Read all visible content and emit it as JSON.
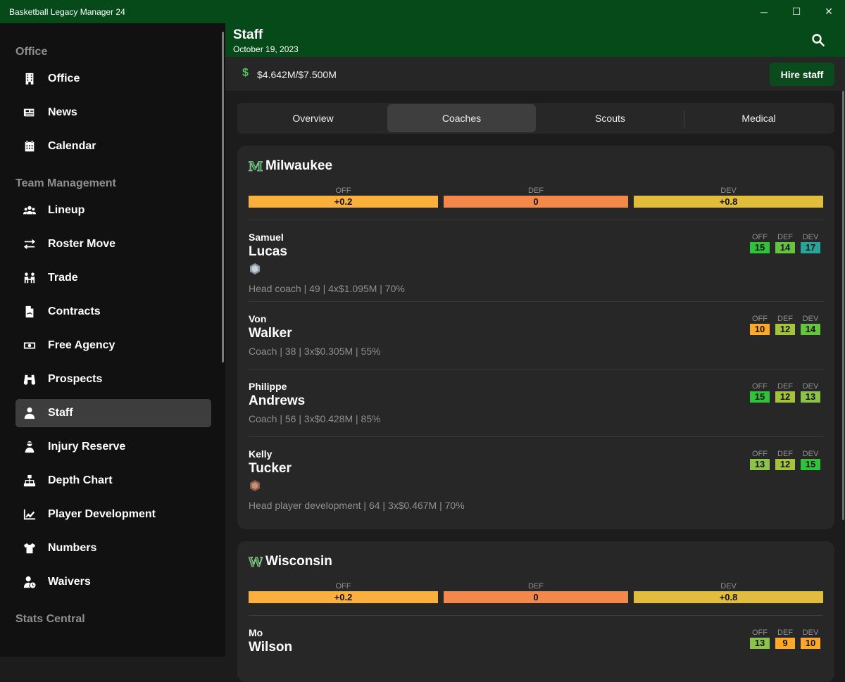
{
  "window": {
    "title": "Basketball Legacy Manager 24",
    "minimize": "─",
    "maximize": "☐",
    "close": "✕"
  },
  "sidebar": {
    "sections": [
      {
        "label": "Office",
        "items": [
          {
            "label": "Office",
            "icon": "building-icon"
          },
          {
            "label": "News",
            "icon": "newspaper-icon"
          },
          {
            "label": "Calendar",
            "icon": "calendar-icon"
          }
        ]
      },
      {
        "label": "Team Management",
        "items": [
          {
            "label": "Lineup",
            "icon": "users-icon"
          },
          {
            "label": "Roster Move",
            "icon": "arrows-exchange-icon"
          },
          {
            "label": "Trade",
            "icon": "trade-icon"
          },
          {
            "label": "Contracts",
            "icon": "contract-icon"
          },
          {
            "label": "Free Agency",
            "icon": "money-bill-icon"
          },
          {
            "label": "Prospects",
            "icon": "binoculars-icon"
          },
          {
            "label": "Staff",
            "icon": "user-tie-icon",
            "active": true
          },
          {
            "label": "Injury Reserve",
            "icon": "user-injured-icon"
          },
          {
            "label": "Depth Chart",
            "icon": "sitemap-icon"
          },
          {
            "label": "Player Development",
            "icon": "chart-line-icon"
          },
          {
            "label": "Numbers",
            "icon": "shirt-icon"
          },
          {
            "label": "Waivers",
            "icon": "user-clock-icon"
          }
        ]
      },
      {
        "label": "Stats Central",
        "items": []
      }
    ]
  },
  "header": {
    "title": "Staff",
    "date": "October 19, 2023"
  },
  "budget": {
    "symbol": "$",
    "amount": "$4.642M/$7.500M",
    "hire_label": "Hire staff"
  },
  "tabs": [
    {
      "label": "Overview"
    },
    {
      "label": "Coaches",
      "active": true
    },
    {
      "label": "Scouts"
    },
    {
      "label": "Medical"
    }
  ],
  "colors": {
    "green_bright": "#2fc23a",
    "green_light": "#8bc34a",
    "teal": "#26a69a",
    "orange": "#ffa726",
    "orange_yellow": "#fbb03b",
    "orange_red": "#f4884a",
    "mustard": "#e2bd3c"
  },
  "teams": [
    {
      "name": "Milwaukee",
      "logo": "M",
      "team_ratings": [
        {
          "label": "OFF",
          "value": "+0.2",
          "color": "#fbb03b"
        },
        {
          "label": "DEF",
          "value": "0",
          "color": "#f4884a"
        },
        {
          "label": "DEV",
          "value": "+0.8",
          "color": "#e2bd3c"
        }
      ],
      "staff": [
        {
          "first": "Samuel",
          "last": "Lucas",
          "badge": "silver",
          "meta": "Head coach | 49 | 4x$1.095M | 70%",
          "ratings": [
            {
              "label": "OFF",
              "value": "15",
              "color": "#2fc23a"
            },
            {
              "label": "DEF",
              "value": "14",
              "color": "#66c33f"
            },
            {
              "label": "DEV",
              "value": "17",
              "color": "#26a69a"
            }
          ]
        },
        {
          "first": "Von",
          "last": "Walker",
          "meta": "Coach | 38 | 3x$0.305M | 55%",
          "ratings": [
            {
              "label": "OFF",
              "value": "10",
              "color": "#ffa726"
            },
            {
              "label": "DEF",
              "value": "12",
              "color": "#a4c23c"
            },
            {
              "label": "DEV",
              "value": "14",
              "color": "#66c33f"
            }
          ]
        },
        {
          "first": "Philippe",
          "last": "Andrews",
          "meta": "Coach | 56 | 3x$0.428M | 85%",
          "ratings": [
            {
              "label": "OFF",
              "value": "15",
              "color": "#2fc23a"
            },
            {
              "label": "DEF",
              "value": "12",
              "color": "#a4c23c"
            },
            {
              "label": "DEV",
              "value": "13",
              "color": "#8bc34a"
            }
          ]
        },
        {
          "first": "Kelly",
          "last": "Tucker",
          "badge": "bronze",
          "meta": "Head player development | 64 | 3x$0.467M | 70%",
          "ratings": [
            {
              "label": "OFF",
              "value": "13",
              "color": "#8bc34a"
            },
            {
              "label": "DEF",
              "value": "12",
              "color": "#a4c23c"
            },
            {
              "label": "DEV",
              "value": "15",
              "color": "#2fc23a"
            }
          ]
        }
      ]
    },
    {
      "name": "Wisconsin",
      "logo": "W",
      "team_ratings": [
        {
          "label": "OFF",
          "value": "+0.2",
          "color": "#fbb03b"
        },
        {
          "label": "DEF",
          "value": "0",
          "color": "#f4884a"
        },
        {
          "label": "DEV",
          "value": "+0.8",
          "color": "#e2bd3c"
        }
      ],
      "staff": [
        {
          "first": "Mo",
          "last": "Wilson",
          "meta": "",
          "ratings": [
            {
              "label": "OFF",
              "value": "13",
              "color": "#8bc34a"
            },
            {
              "label": "DEF",
              "value": "9",
              "color": "#ffa726"
            },
            {
              "label": "DEV",
              "value": "10",
              "color": "#ffa726"
            }
          ]
        }
      ]
    }
  ]
}
